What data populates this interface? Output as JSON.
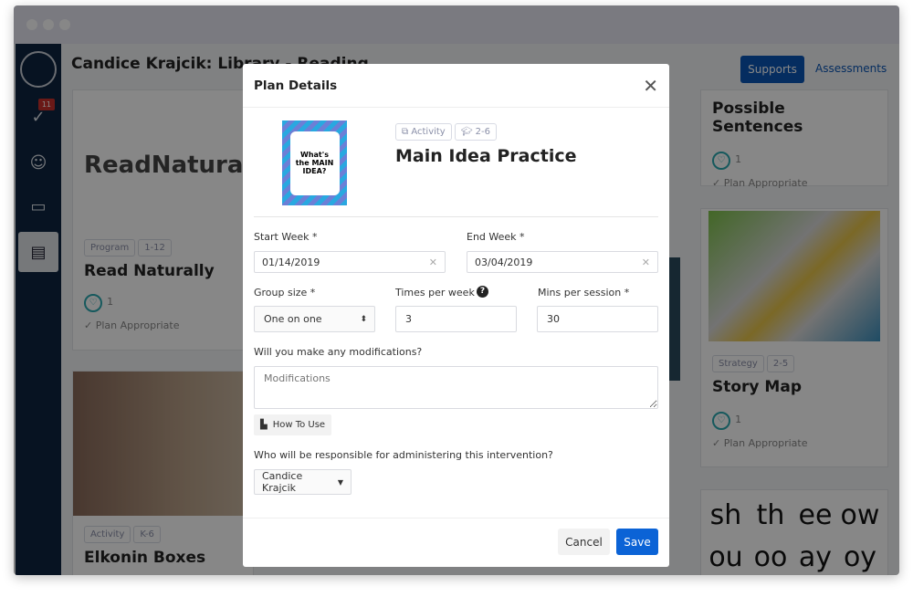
{
  "header": {
    "title": "Candice Krajcik: Library - Reading",
    "supports": "Supports",
    "assessments": "Assessments"
  },
  "sidebar": {
    "badge": "11",
    "items": [
      "check-icon",
      "student-icon",
      "classroom-icon",
      "book-icon"
    ]
  },
  "cards": [
    {
      "logo_text": "ReadNaturally",
      "type": "Program",
      "grades": "1-12",
      "title": "Read Naturally",
      "likes": "1",
      "status": "✓ Plan Appropriate"
    },
    {
      "type": "Activity",
      "grades": "K-6",
      "title": "Elkonin Boxes"
    },
    {
      "title": "Possible Sentences",
      "likes": "1",
      "status": "✓ Plan Appropriate"
    },
    {
      "type": "Strategy",
      "grades": "2-5",
      "title": "Story Map",
      "likes": "1",
      "status": "✓ Plan Appropriate"
    },
    {
      "phonics": [
        "sh",
        "th",
        "ee",
        "ow",
        "ou",
        "oo",
        "ay",
        "oy"
      ]
    }
  ],
  "modal": {
    "title": "Plan Details",
    "thumb_text": "What's the MAIN IDEA?",
    "type": "Activity",
    "grades": "2-6",
    "name": "Main Idea Practice",
    "start_label": "Start Week *",
    "start_value": "01/14/2019",
    "end_label": "End Week *",
    "end_value": "03/04/2019",
    "group_label": "Group size *",
    "group_value": "One on one",
    "times_label": "Times per week *",
    "times_value": "3",
    "mins_label": "Mins per session *",
    "mins_value": "30",
    "mod_label": "Will you make any modifications?",
    "mod_placeholder": "Modifications",
    "how_to": "How To Use",
    "resp_label": "Who will be responsible for administering this intervention?",
    "resp_value": "Candice Krajcik",
    "cancel": "Cancel",
    "save": "Save"
  },
  "colors": {
    "primary": "#0b56b5",
    "sidebar": "#0f2440",
    "accent": "#2aa9b0"
  }
}
